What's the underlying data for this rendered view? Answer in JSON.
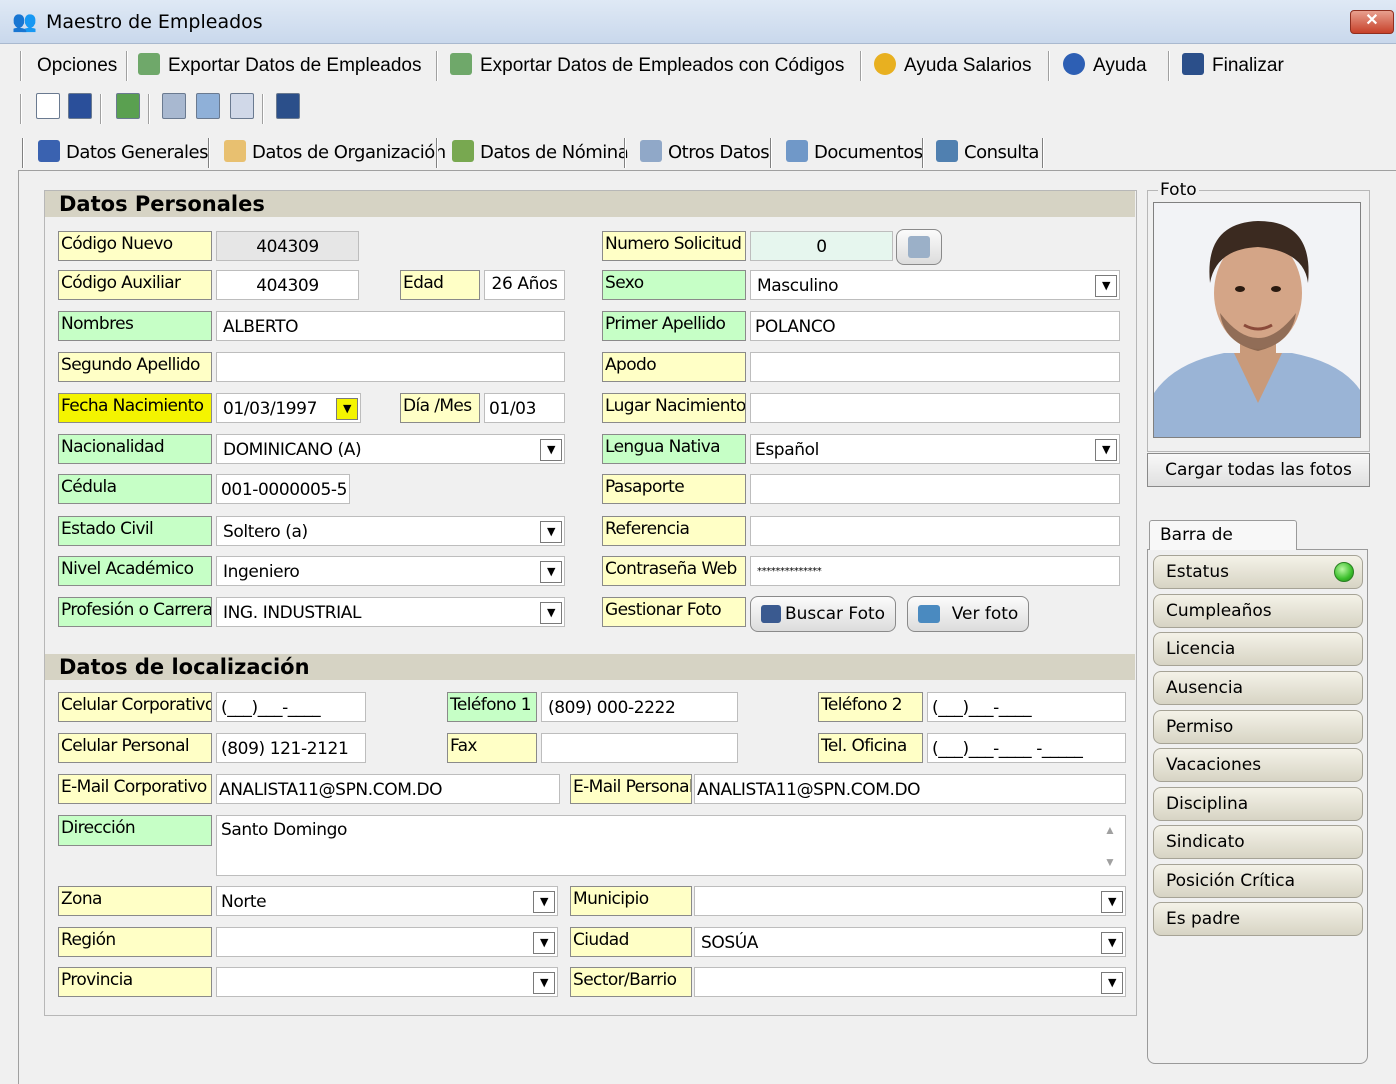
{
  "window": {
    "title": "Maestro de Empleados",
    "close": "✕"
  },
  "menu": {
    "opciones": "Opciones",
    "exportar": "Exportar Datos de Empleados",
    "exportar_codigos": "Exportar Datos de Empleados con Códigos",
    "ayuda_salarios": "Ayuda Salarios",
    "ayuda": "Ayuda",
    "finalizar": "Finalizar"
  },
  "toolbar": {
    "icons": [
      "new-icon",
      "save-icon",
      "refresh-icon",
      "print-preview-icon",
      "import-icon",
      "report-icon",
      "exit-icon"
    ]
  },
  "tabs": {
    "generales": "Datos Generales",
    "organizacion": "Datos de Organización",
    "nomina": "Datos de Nómina",
    "otros": "Otros Datos",
    "documentos": "Documentos",
    "consulta": "Consulta"
  },
  "personal": {
    "header": "Datos Personales",
    "codigo_nuevo_label": "Código Nuevo",
    "codigo_nuevo": "404309",
    "codigo_aux_label": "Código Auxiliar",
    "codigo_aux": "404309",
    "edad_label": "Edad",
    "edad": "26 Años",
    "nombres_label": "Nombres",
    "nombres": "ALBERTO",
    "segundo_apellido_label": "Segundo Apellido",
    "segundo_apellido": "",
    "fecha_nac_label": "Fecha Nacimiento",
    "fecha_nac": "01/03/1997",
    "dia_mes_label": "Día /Mes",
    "dia_mes": "01/03",
    "nacionalidad_label": "Nacionalidad",
    "nacionalidad": "DOMINICANO (A)",
    "cedula_label": "Cédula",
    "cedula": "001-0000005-5",
    "estado_civil_label": "Estado Civil",
    "estado_civil": "Soltero (a)",
    "nivel_label": "Nivel Académico",
    "nivel": "Ingeniero",
    "profesion_label": "Profesión o Carrera",
    "profesion": "ING. INDUSTRIAL",
    "numero_sol_label": "Numero Solicitud",
    "numero_sol": "0",
    "sexo_label": "Sexo",
    "sexo": "Masculino",
    "primer_apellido_label": "Primer Apellido",
    "primer_apellido": "POLANCO",
    "apodo_label": "Apodo",
    "apodo": "",
    "lugar_nac_label": "Lugar Nacimiento",
    "lugar_nac": "",
    "lengua_label": "Lengua Nativa",
    "lengua": "Español",
    "pasaporte_label": "Pasaporte",
    "pasaporte": "",
    "referencia_label": "Referencia",
    "referencia": "",
    "contrasena_label": "Contraseña Web",
    "contrasena": "**************",
    "gestionar_label": "Gestionar Foto",
    "buscar_foto": "Buscar Foto",
    "ver_foto": "Ver foto"
  },
  "localizacion": {
    "header": "Datos de localización",
    "cel_corp_label": "Celular Corporativo",
    "cel_corp": "(___)___-____",
    "cel_pers_label": "Celular Personal",
    "cel_pers": "(809) 121-2121",
    "tel1_label": "Teléfono 1",
    "tel1": "(809) 000-2222",
    "fax_label": "Fax",
    "fax": "",
    "tel2_label": "Teléfono 2",
    "tel2": "(___)___-____",
    "tel_ofi_label": "Tel. Oficina",
    "tel_ofi": "(___)___-____ -_____",
    "email_corp_label": "E-Mail Corporativo",
    "email_corp": "ANALISTA11@SPN.COM.DO",
    "email_pers_label": "E-Mail Personal",
    "email_pers": "ANALISTA11@SPN.COM.DO",
    "direccion_label": "Dirección",
    "direccion": "Santo Domingo",
    "zona_label": "Zona",
    "zona": "Norte",
    "region_label": "Región",
    "region": "",
    "provincia_label": "Provincia",
    "provincia": "",
    "municipio_label": "Municipio",
    "municipio": "",
    "ciudad_label": "Ciudad",
    "ciudad": "SOSÚA",
    "sector_label": "Sector/Barrio",
    "sector": ""
  },
  "foto": {
    "label": "Foto",
    "cargar": "Cargar todas las fotos"
  },
  "barra": {
    "tab": "Barra de Estado",
    "items": [
      "Estatus",
      "Cumpleaños",
      "Licencia",
      "Ausencia",
      "Permiso",
      "Vacaciones",
      "Disciplina",
      "Sindicato",
      "Posición Crítica",
      "Es padre"
    ]
  }
}
